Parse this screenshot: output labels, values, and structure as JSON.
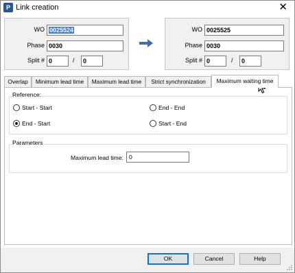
{
  "window": {
    "title": "Link creation",
    "app_icon_letter": "P"
  },
  "left_panel": {
    "wo_label": "WO",
    "wo_value": "0025524",
    "phase_label": "Phase",
    "phase_value": "0030",
    "split_label": "Split #",
    "split_a": "0",
    "split_sep": "/",
    "split_b": "0"
  },
  "right_panel": {
    "wo_label": "WO",
    "wo_value": "0025525",
    "phase_label": "Phase",
    "phase_value": "0030",
    "split_label": "Split #",
    "split_a": "0",
    "split_sep": "/",
    "split_b": "0"
  },
  "tabs": [
    {
      "label": "Overlap"
    },
    {
      "label": "Minimum lead time"
    },
    {
      "label": "Maximum lead time"
    },
    {
      "label": "Strict synchronization"
    },
    {
      "label": "Maximum waiting time",
      "active": true
    }
  ],
  "reference": {
    "title": "Reference:",
    "options": [
      {
        "label": "Start - Start",
        "checked": false
      },
      {
        "label": "End - End",
        "checked": false
      },
      {
        "label": "End - Start",
        "checked": true
      },
      {
        "label": "Start - End",
        "checked": false
      }
    ]
  },
  "parameters": {
    "title": "Parameters",
    "max_lead_label": "Maximum lead time:",
    "max_lead_value": "0"
  },
  "buttons": {
    "ok": "OK",
    "cancel": "Cancel",
    "help": "Help"
  },
  "colors": {
    "arrow": "#3d6fa8",
    "selection": "#3d7fd6",
    "default_button_border": "#0078d7"
  }
}
